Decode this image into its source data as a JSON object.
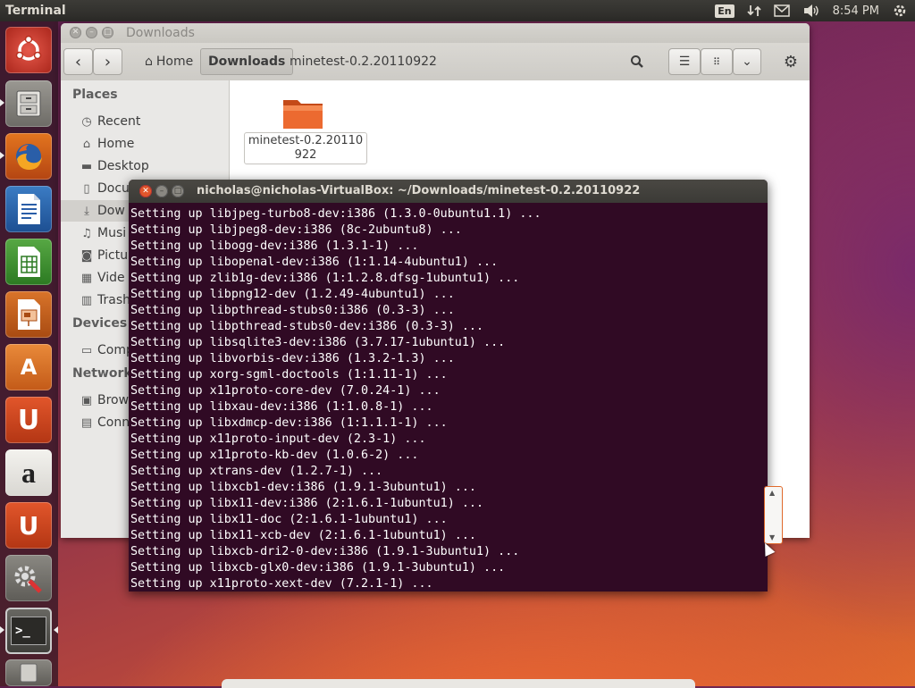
{
  "top_panel": {
    "app_title": "Terminal",
    "keyboard_layout": "En",
    "clock": "8:54 PM",
    "icons": [
      "network-icon",
      "mail-icon",
      "volume-icon",
      "settings-icon"
    ]
  },
  "launcher": {
    "items": [
      {
        "name": "dash-home",
        "icon": "ubuntu-logo-icon"
      },
      {
        "name": "files",
        "icon": "file-cabinet-icon"
      },
      {
        "name": "firefox",
        "icon": "firefox-icon"
      },
      {
        "name": "libreoffice-writer",
        "icon": "writer-icon"
      },
      {
        "name": "libreoffice-calc",
        "icon": "calc-icon"
      },
      {
        "name": "libreoffice-impress",
        "icon": "impress-icon"
      },
      {
        "name": "software-center",
        "icon": "bag-icon",
        "glyph": "A"
      },
      {
        "name": "ubuntu-one",
        "icon": "ubuntu-one-icon",
        "glyph": "U"
      },
      {
        "name": "amazon",
        "icon": "amazon-icon",
        "glyph": "a"
      },
      {
        "name": "ubuntu-one-music",
        "icon": "headphones-icon",
        "glyph": "U"
      },
      {
        "name": "system-settings",
        "icon": "wrench-gear-icon"
      },
      {
        "name": "terminal",
        "icon": "terminal-icon",
        "glyph": ">_"
      },
      {
        "name": "trash",
        "icon": "trash-icon"
      }
    ]
  },
  "file_manager": {
    "title": "Downloads",
    "breadcrumbs": [
      "Home",
      "Downloads",
      "minetest-0.2.20110922"
    ],
    "sidebar": {
      "places_header": "Places",
      "places": [
        "Recent",
        "Home",
        "Desktop",
        "Docu",
        "Dow",
        "Musi",
        "Pictu",
        "Vide",
        "Trash"
      ],
      "devices_header": "Devices",
      "devices": [
        "Comp"
      ],
      "network_header": "Network",
      "network": [
        "Brow",
        "Conn"
      ]
    },
    "folder": {
      "name": "minetest-0.2.20110922",
      "color": "#e8622a"
    }
  },
  "terminal": {
    "title": "nicholas@nicholas-VirtualBox: ~/Downloads/minetest-0.2.20110922",
    "lines": [
      "Setting up libjpeg-turbo8-dev:i386 (1.3.0-0ubuntu1.1) ...",
      "Setting up libjpeg8-dev:i386 (8c-2ubuntu8) ...",
      "Setting up libogg-dev:i386 (1.3.1-1) ...",
      "Setting up libopenal-dev:i386 (1:1.14-4ubuntu1) ...",
      "Setting up zlib1g-dev:i386 (1:1.2.8.dfsg-1ubuntu1) ...",
      "Setting up libpng12-dev (1.2.49-4ubuntu1) ...",
      "Setting up libpthread-stubs0:i386 (0.3-3) ...",
      "Setting up libpthread-stubs0-dev:i386 (0.3-3) ...",
      "Setting up libsqlite3-dev:i386 (3.7.17-1ubuntu1) ...",
      "Setting up libvorbis-dev:i386 (1.3.2-1.3) ...",
      "Setting up xorg-sgml-doctools (1:1.11-1) ...",
      "Setting up x11proto-core-dev (7.0.24-1) ...",
      "Setting up libxau-dev:i386 (1:1.0.8-1) ...",
      "Setting up libxdmcp-dev:i386 (1:1.1.1-1) ...",
      "Setting up x11proto-input-dev (2.3-1) ...",
      "Setting up x11proto-kb-dev (1.0.6-2) ...",
      "Setting up xtrans-dev (1.2.7-1) ...",
      "Setting up libxcb1-dev:i386 (1.9.1-3ubuntu1) ...",
      "Setting up libx11-dev:i386 (2:1.6.1-1ubuntu1) ...",
      "Setting up libx11-doc (2:1.6.1-1ubuntu1) ...",
      "Setting up libx11-xcb-dev (2:1.6.1-1ubuntu1) ...",
      "Setting up libxcb-dri2-0-dev:i386 (1.9.1-3ubuntu1) ...",
      "Setting up libxcb-glx0-dev:i386 (1.9.1-3ubuntu1) ...",
      "Setting up x11proto-xext-dev (7.2.1-1) ..."
    ]
  }
}
